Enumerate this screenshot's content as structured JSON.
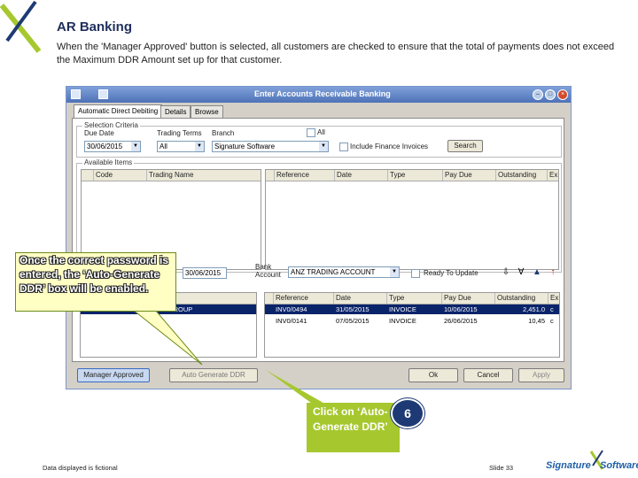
{
  "slide": {
    "title": "AR Banking",
    "description": "When the 'Manager Approved' button is selected, all customers are checked to ensure that the total of payments does not exceed the Maximum DDR Amount set up for that customer.",
    "footer_note": "Data displayed is fictional",
    "slide_number": "Slide 33",
    "brand_left": "Signature",
    "brand_right": "Software",
    "step_number": "6"
  },
  "window": {
    "title": "Enter Accounts Receivable Banking",
    "tabs": [
      "Automatic Direct Debiting",
      "Details",
      "Browse"
    ]
  },
  "selection": {
    "group_label": "Selection Criteria",
    "due_date_label": "Due Date",
    "due_date_value": "30/06/2015",
    "trading_terms_label": "Trading Terms",
    "trading_terms_value": "All",
    "branch_label": "Branch",
    "branch_value": "Signature Software",
    "all_label": "All",
    "include_finance_label": "Include Finance Invoices",
    "search_button": "Search"
  },
  "available": {
    "group_label": "Available Items",
    "left_columns": [
      "Code",
      "Trading Name"
    ],
    "right_columns": [
      "Reference",
      "Date",
      "Type",
      "Pay Due",
      "Outstanding",
      "Ex"
    ]
  },
  "banking": {
    "date_value": "30/06/2015",
    "bank_account_label": "Bank Account",
    "bank_account_value": "ANZ TRADING ACCOUNT",
    "ready_label": "Ready To Update"
  },
  "selected": {
    "left_columns": [
      "Name"
    ],
    "left_rows": [
      [
        "DEFERRED ... EL SELL GROUP"
      ]
    ],
    "right_columns": [
      "Reference",
      "Date",
      "Type",
      "Pay Due",
      "Outstanding",
      "Ex"
    ],
    "right_rows": [
      [
        "INV0/0494",
        "31/05/2015",
        "INVOICE",
        "10/06/2015",
        "2,451.0",
        "c"
      ],
      [
        "INV0/0141",
        "07/05/2015",
        "INVOICE",
        "26/06/2015",
        "10,45",
        "c"
      ]
    ]
  },
  "buttons": {
    "manager_approved": "Manager Approved",
    "auto_generate": "Auto Generate DDR",
    "ok": "Ok",
    "cancel": "Cancel",
    "apply": "Apply"
  },
  "callouts": {
    "password": "Once the correct password is entered, the ‘Auto-Generate DDR’ box will be enabled.",
    "click": "Click on ‘Auto-Generate DDR’"
  },
  "colors": {
    "title": "#1f2f5c",
    "selected_row": "#0a246a",
    "callout_green": "#a6c82e",
    "step_circle": "#1d3a74"
  }
}
